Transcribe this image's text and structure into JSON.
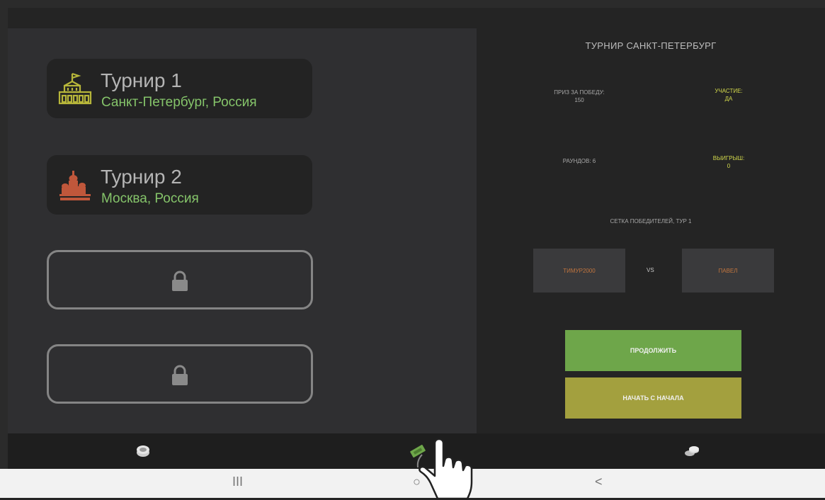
{
  "tournaments": [
    {
      "name": "Турнир 1",
      "city": "Санкт-Петербург, Россия",
      "icon": "palace-icon",
      "icon_color": "#b7b63a"
    },
    {
      "name": "Турнир 2",
      "city": "Москва, Россия",
      "icon": "kremlin-icon",
      "icon_color": "#c0573b"
    }
  ],
  "locked_slots": 2,
  "detail": {
    "title": "ТУРНИР САНКТ-ПЕТЕРБУРГ",
    "prize_label": "ПРИЗ ЗА ПОБЕДУ:",
    "prize_value": "150",
    "participation_label": "УЧАСТИЕ:",
    "participation_value": "ДА",
    "rounds_label": "РАУНДОВ: 6",
    "winnings_label": "ВЫИГРЫШ:",
    "winnings_value": "0",
    "bracket_label": "СЕТКА ПОБЕДИТЕЛЕЙ, ТУР 1",
    "player1": "ТИМУР2000",
    "vs": "VS",
    "player2": "ПАВЕЛ",
    "continue_label": "ПРОДОЛЖИТЬ",
    "restart_label": "НАЧАТЬ С НАЧАЛА"
  },
  "tabs": [
    {
      "icon": "stack-icon"
    },
    {
      "icon": "ticket-icon",
      "active_color": "#6ea64a"
    },
    {
      "icon": "coins-icon"
    }
  ],
  "navbar": {
    "recents": "III",
    "home": "○",
    "back": "<"
  },
  "colors": {
    "accent_green": "#6ea64a",
    "accent_olive": "#a3a03e",
    "city_green": "#85c46a",
    "player_orange": "#c2753e"
  }
}
